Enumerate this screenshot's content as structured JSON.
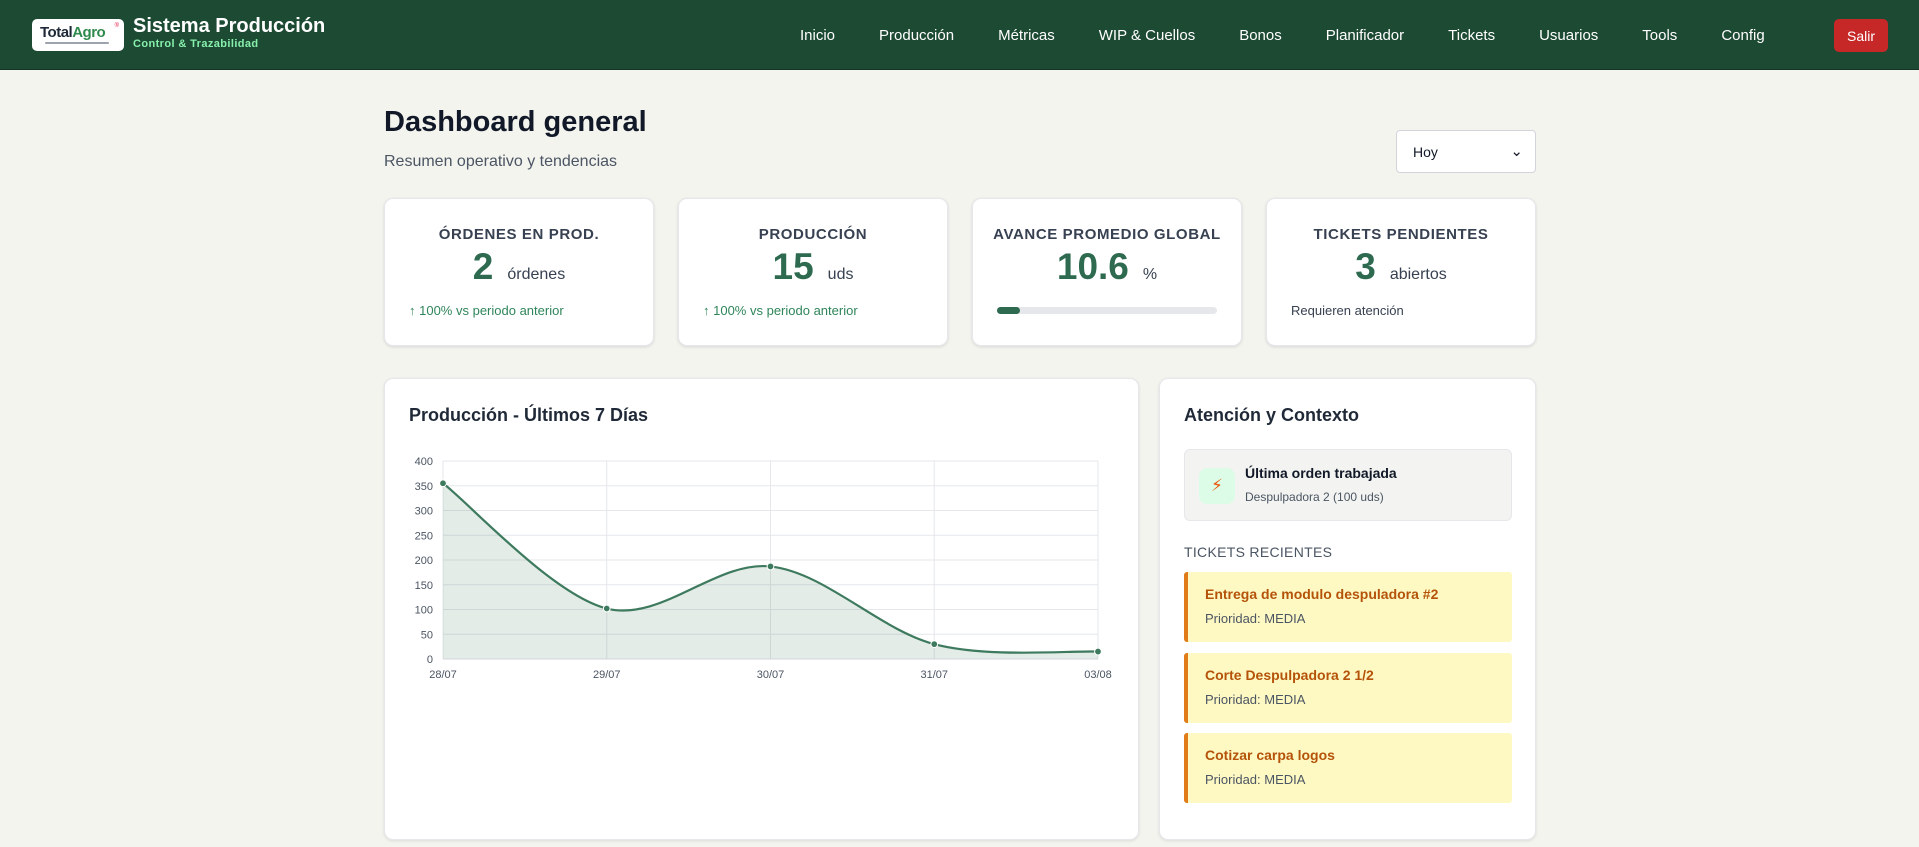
{
  "navbar": {
    "logo": {
      "word_a": "Total",
      "word_b": "Agro",
      "reg": "®"
    },
    "title": "Sistema Producción",
    "subtitle": "Control & Trazabilidad",
    "links": [
      "Inicio",
      "Producción",
      "Métricas",
      "WIP & Cuellos",
      "Bonos",
      "Planificador",
      "Tickets",
      "Usuarios",
      "Tools",
      "Config"
    ],
    "logout_label": "Salir"
  },
  "header": {
    "title": "Dashboard general",
    "subtitle": "Resumen operativo y tendencias",
    "period": "Hoy"
  },
  "kpis": [
    {
      "label": "ÓRDENES EN PROD.",
      "value": "2",
      "unit": "órdenes",
      "trend": "↑ 100% vs periodo anterior"
    },
    {
      "label": "PRODUCCIÓN",
      "value": "15",
      "unit": "uds",
      "trend": "↑ 100% vs periodo anterior"
    },
    {
      "label": "AVANCE PROMEDIO GLOBAL",
      "value": "10.6",
      "unit": "%",
      "progress": 0.106
    },
    {
      "label": "TICKETS PENDIENTES",
      "value": "3",
      "unit": "abiertos",
      "note": "Requieren atención"
    }
  ],
  "production_chart": {
    "title": "Producción - Últimos 7 Días"
  },
  "chart_data": {
    "type": "area",
    "title": "",
    "categories": [
      "28/07",
      "29/07",
      "30/07",
      "31/07",
      "03/08"
    ],
    "series": [
      {
        "values": [
          355,
          102,
          187,
          30,
          15
        ]
      }
    ],
    "ylim": [
      0,
      400
    ],
    "yticks": [
      0,
      50,
      100,
      150,
      200,
      250,
      300,
      350,
      400
    ],
    "grid": true,
    "color": "#3d7a5e"
  },
  "context": {
    "title": "Atención y Contexto",
    "last_order_title": "Última orden trabajada",
    "last_order_detail": "Despulpadora 2 (100 uds)",
    "bolt_icon": "⚡",
    "tickets_heading": "TICKETS RECIENTES",
    "tickets": [
      {
        "title": "Entrega de modulo despuladora #2",
        "priority": "Prioridad: MEDIA"
      },
      {
        "title": "Corte Despulpadora 2 1/2",
        "priority": "Prioridad: MEDIA"
      },
      {
        "title": "Cotizar carpa logos",
        "priority": "Prioridad: MEDIA"
      }
    ]
  },
  "colors": {
    "navbar": "#1d4a33",
    "accent": "#2d6a4f",
    "danger": "#c62828",
    "ticket_bg": "#fef9c3",
    "ticket_border": "#e07b18"
  }
}
